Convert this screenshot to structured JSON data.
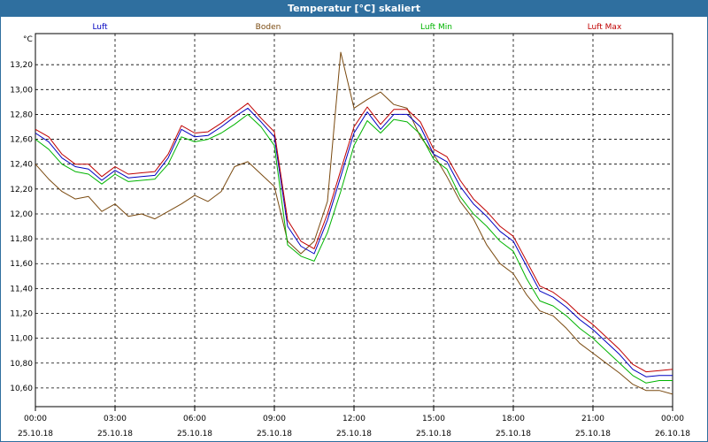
{
  "window": {
    "title": "Temperatur [°C] skaliert"
  },
  "chart_data": {
    "type": "line",
    "title": "Temperatur [°C] skaliert",
    "yunit": "°C",
    "ylim": [
      10.45,
      13.45
    ],
    "y_ticks": [
      "13,20",
      "13,00",
      "12,80",
      "12,60",
      "12,40",
      "12,20",
      "12,00",
      "11,80",
      "11,60",
      "11,40",
      "11,20",
      "11,00",
      "10,80",
      "10,60"
    ],
    "y_tick_values": [
      13.2,
      13.0,
      12.8,
      12.6,
      12.4,
      12.2,
      12.0,
      11.8,
      11.6,
      11.4,
      11.2,
      11.0,
      10.8,
      10.6
    ],
    "xlim": [
      0,
      24
    ],
    "x_tick_values": [
      0,
      3,
      6,
      9,
      12,
      15,
      18,
      21,
      24
    ],
    "x_ticks": [
      {
        "time": "00:00",
        "date": "25.10.18"
      },
      {
        "time": "03:00",
        "date": "25.10.18"
      },
      {
        "time": "06:00",
        "date": "25.10.18"
      },
      {
        "time": "09:00",
        "date": "25.10.18"
      },
      {
        "time": "12:00",
        "date": "25.10.18"
      },
      {
        "time": "15:00",
        "date": "25.10.18"
      },
      {
        "time": "18:00",
        "date": "25.10.18"
      },
      {
        "time": "21:00",
        "date": "25.10.18"
      },
      {
        "time": "00:00",
        "date": "26.10.18"
      }
    ],
    "grid": true,
    "x": [
      0,
      0.5,
      1,
      1.5,
      2,
      2.5,
      3,
      3.5,
      4,
      4.5,
      5,
      5.5,
      6,
      6.5,
      7,
      7.5,
      8,
      8.5,
      9,
      9.5,
      10,
      10.5,
      11,
      11.5,
      12,
      12.5,
      13,
      13.5,
      14,
      14.5,
      15,
      15.5,
      16,
      16.5,
      17,
      17.5,
      18,
      18.5,
      19,
      19.5,
      20,
      20.5,
      21,
      21.5,
      22,
      22.5,
      23,
      23.5,
      24
    ],
    "series": [
      {
        "name": "Luft",
        "color": "#0000c0",
        "values": [
          12.65,
          12.58,
          12.45,
          12.38,
          12.36,
          12.27,
          12.35,
          12.29,
          12.3,
          12.31,
          12.45,
          12.68,
          12.62,
          12.63,
          12.7,
          12.78,
          12.85,
          12.74,
          12.62,
          11.9,
          11.74,
          11.68,
          11.95,
          12.3,
          12.65,
          12.82,
          12.68,
          12.8,
          12.8,
          12.7,
          12.48,
          12.42,
          12.22,
          12.08,
          11.98,
          11.86,
          11.78,
          11.58,
          11.38,
          11.33,
          11.25,
          11.15,
          11.07,
          10.97,
          10.87,
          10.75,
          10.69,
          10.7,
          10.7
        ]
      },
      {
        "name": "Boden",
        "color": "#7a4a10",
        "values": [
          12.4,
          12.28,
          12.18,
          12.12,
          12.14,
          12.02,
          12.08,
          11.98,
          12.0,
          11.96,
          12.02,
          12.08,
          12.15,
          12.1,
          12.18,
          12.38,
          12.42,
          12.32,
          12.22,
          11.78,
          11.68,
          11.78,
          12.1,
          13.3,
          12.85,
          12.92,
          12.98,
          12.88,
          12.85,
          12.62,
          12.48,
          12.3,
          12.1,
          11.96,
          11.75,
          11.6,
          11.52,
          11.35,
          11.22,
          11.18,
          11.08,
          10.96,
          10.88,
          10.8,
          10.72,
          10.63,
          10.58,
          10.58,
          10.55
        ]
      },
      {
        "name": "Luft Min",
        "color": "#00b400",
        "values": [
          12.6,
          12.52,
          12.4,
          12.34,
          12.32,
          12.24,
          12.32,
          12.26,
          12.27,
          12.28,
          12.4,
          12.62,
          12.58,
          12.6,
          12.65,
          12.72,
          12.8,
          12.7,
          12.55,
          11.75,
          11.66,
          11.62,
          11.85,
          12.18,
          12.55,
          12.75,
          12.65,
          12.76,
          12.74,
          12.64,
          12.44,
          12.36,
          12.14,
          12.0,
          11.9,
          11.78,
          11.7,
          11.48,
          11.3,
          11.26,
          11.18,
          11.08,
          11.0,
          10.9,
          10.8,
          10.7,
          10.64,
          10.66,
          10.66
        ]
      },
      {
        "name": "Luft Max",
        "color": "#c00000",
        "values": [
          12.68,
          12.62,
          12.48,
          12.4,
          12.4,
          12.3,
          12.38,
          12.32,
          12.33,
          12.34,
          12.48,
          12.71,
          12.65,
          12.66,
          12.73,
          12.81,
          12.89,
          12.77,
          12.66,
          11.95,
          11.78,
          11.72,
          12.0,
          12.35,
          12.7,
          12.86,
          12.72,
          12.84,
          12.84,
          12.74,
          12.52,
          12.46,
          12.27,
          12.12,
          12.02,
          11.9,
          11.82,
          11.62,
          11.42,
          11.37,
          11.29,
          11.19,
          11.11,
          11.01,
          10.91,
          10.79,
          10.73,
          10.74,
          10.75
        ]
      }
    ]
  }
}
